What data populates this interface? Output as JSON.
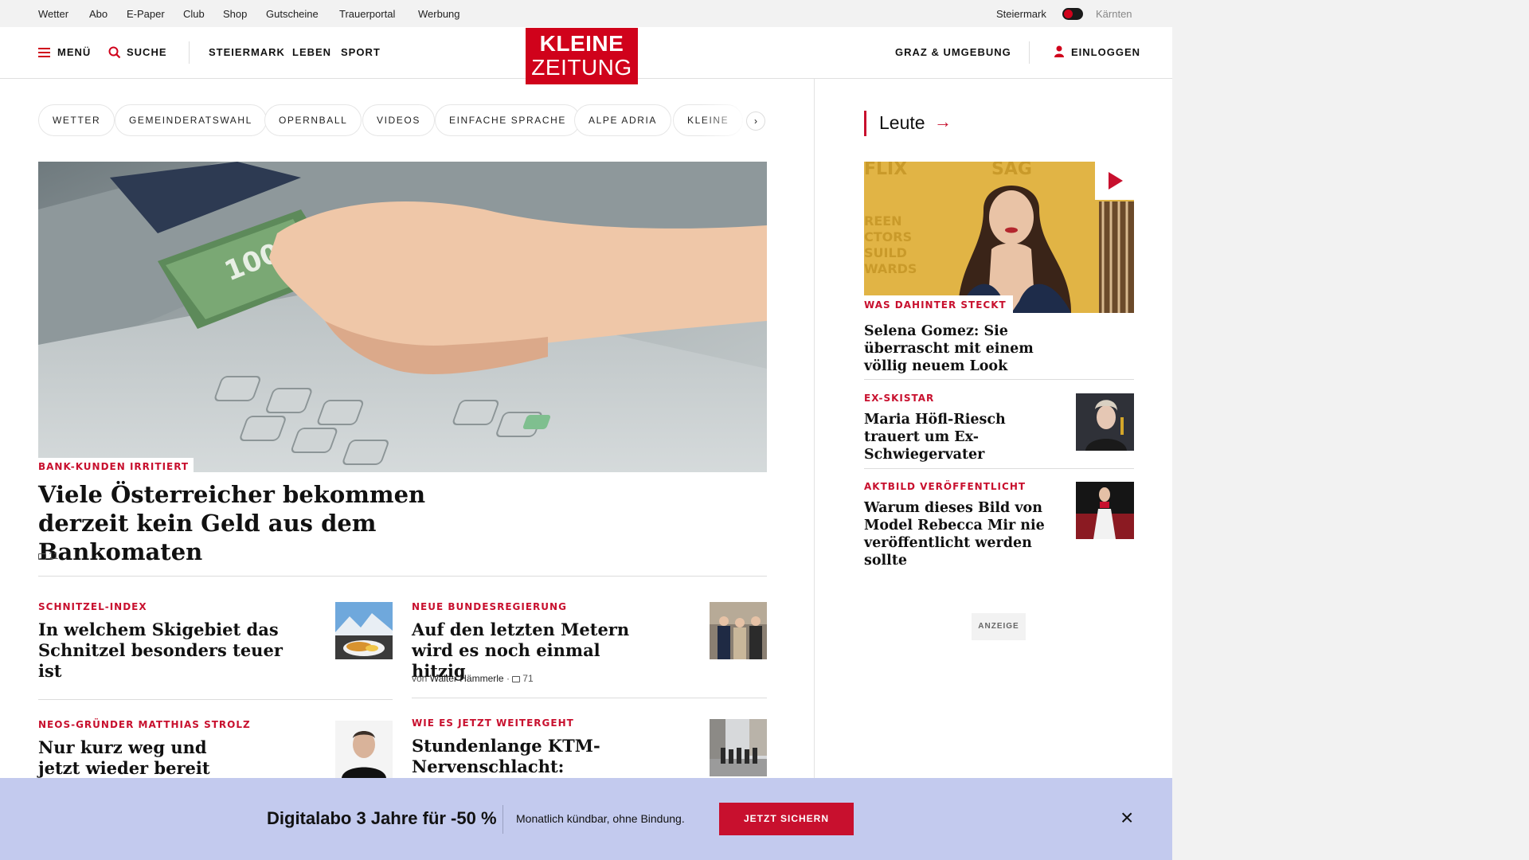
{
  "utility": {
    "links": [
      "Wetter",
      "Abo",
      "E-Paper",
      "Club",
      "Shop",
      "Gutscheine",
      "Trauerportal",
      "Werbung"
    ],
    "region_active": "Steiermark",
    "region_inactive": "Kärnten"
  },
  "nav": {
    "menu": "MENÜ",
    "search": "SUCHE",
    "sections": [
      "STEIERMARK",
      "LEBEN",
      "SPORT"
    ],
    "local": "GRAZ & UMGEBUNG",
    "login": "EINLOGGEN",
    "logo_line1": "KLEINE",
    "logo_line2": "ZEITUNG"
  },
  "chips": [
    "WETTER",
    "GEMEINDERATSWAHL",
    "OPERNBALL",
    "VIDEOS",
    "EINFACHE SPRACHE",
    "ALPE ADRIA",
    "KLEINE"
  ],
  "chip_arrow": "›",
  "hero": {
    "kicker": "BANK-KUNDEN IRRITIERT",
    "title": "Viele Österreicher bekommen derzeit kein Geld aus dem Bankomaten",
    "comments": "11"
  },
  "articles": [
    {
      "kicker": "SCHNITZEL-INDEX",
      "title": "In welchem Skigebiet das Schnitzel besonders teuer ist"
    },
    {
      "kicker": "NEUE BUNDESREGIERUNG",
      "title": "Auf den letzten Metern wird es noch einmal hitzig",
      "author_prefix": "von",
      "author": "Walter Hämmerle",
      "comments": "71"
    },
    {
      "kicker": "NEOS-GRÜNDER MATTHIAS STROLZ",
      "title": "Nur kurz weg und jetzt wieder bereit"
    },
    {
      "kicker": "WIE ES JETZT WEITERGEHT",
      "title": "Stundenlange KTM-Nervenschlacht: Gläubiger"
    }
  ],
  "side": {
    "section": "Leute",
    "arrow": "→",
    "items": [
      {
        "kicker": "WAS DAHINTER STECKT",
        "title": "Selena Gomez: Sie überrascht mit einem völlig neuem Look"
      },
      {
        "kicker": "EX-SKISTAR",
        "title": "Maria Höfl-Riesch trauert um Ex-Schwiegervater"
      },
      {
        "kicker": "AKTBILD VERÖFFENTLICHT",
        "title": "Warum dieses Bild von Model Rebecca Mir nie veröffentlicht werden sollte"
      }
    ],
    "ad_label": "ANZEIGE"
  },
  "banner": {
    "title": "Digitalabo 3 Jahre für -50 %",
    "subtitle": "Monatlich kündbar, ohne Bindung.",
    "button": "JETZT SICHERN",
    "close": "×"
  },
  "colors": {
    "brand_red": "#c8102e",
    "logo_red": "#d0021b",
    "banner_bg": "#c3caee"
  }
}
